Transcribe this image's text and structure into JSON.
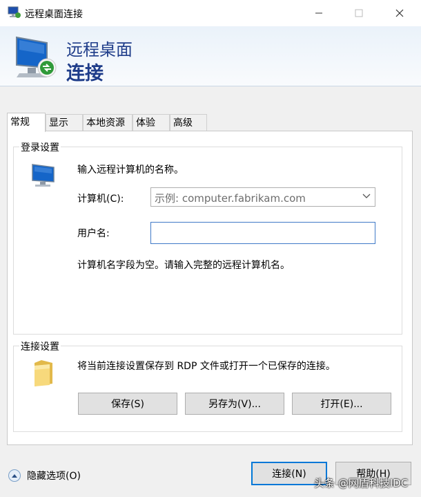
{
  "window": {
    "title": "远程桌面连接",
    "minimize_icon": "minimize-icon",
    "maximize_icon": "maximize-icon",
    "close_icon": "close-icon"
  },
  "banner": {
    "line1": "远程桌面",
    "line2": "连接",
    "icon": "remote-desktop-icon"
  },
  "tabs": [
    "常规",
    "显示",
    "本地资源",
    "体验",
    "高级"
  ],
  "active_tab": "常规",
  "login_settings": {
    "legend": "登录设置",
    "instruction": "输入远程计算机的名称。",
    "computer_label": "计算机(C):",
    "computer_placeholder": "示例: computer.fabrikam.com",
    "username_label": "用户名:",
    "username_value": "",
    "warning": "计算机名字段为空。请输入完整的远程计算机名。"
  },
  "connection_settings": {
    "legend": "连接设置",
    "description": "将当前连接设置保存到 RDP 文件或打开一个已保存的连接。",
    "save_label": "保存(S)",
    "save_as_label": "另存为(V)...",
    "open_label": "打开(E)..."
  },
  "footer": {
    "hide_options_label": "隐藏选项(O)",
    "connect_label": "连接(N)",
    "help_label": "帮助(H)",
    "watermark": "头条 @网盾科技IDC"
  },
  "colors": {
    "banner_text": "#1f3d8a",
    "focus_border": "#0078d7"
  }
}
